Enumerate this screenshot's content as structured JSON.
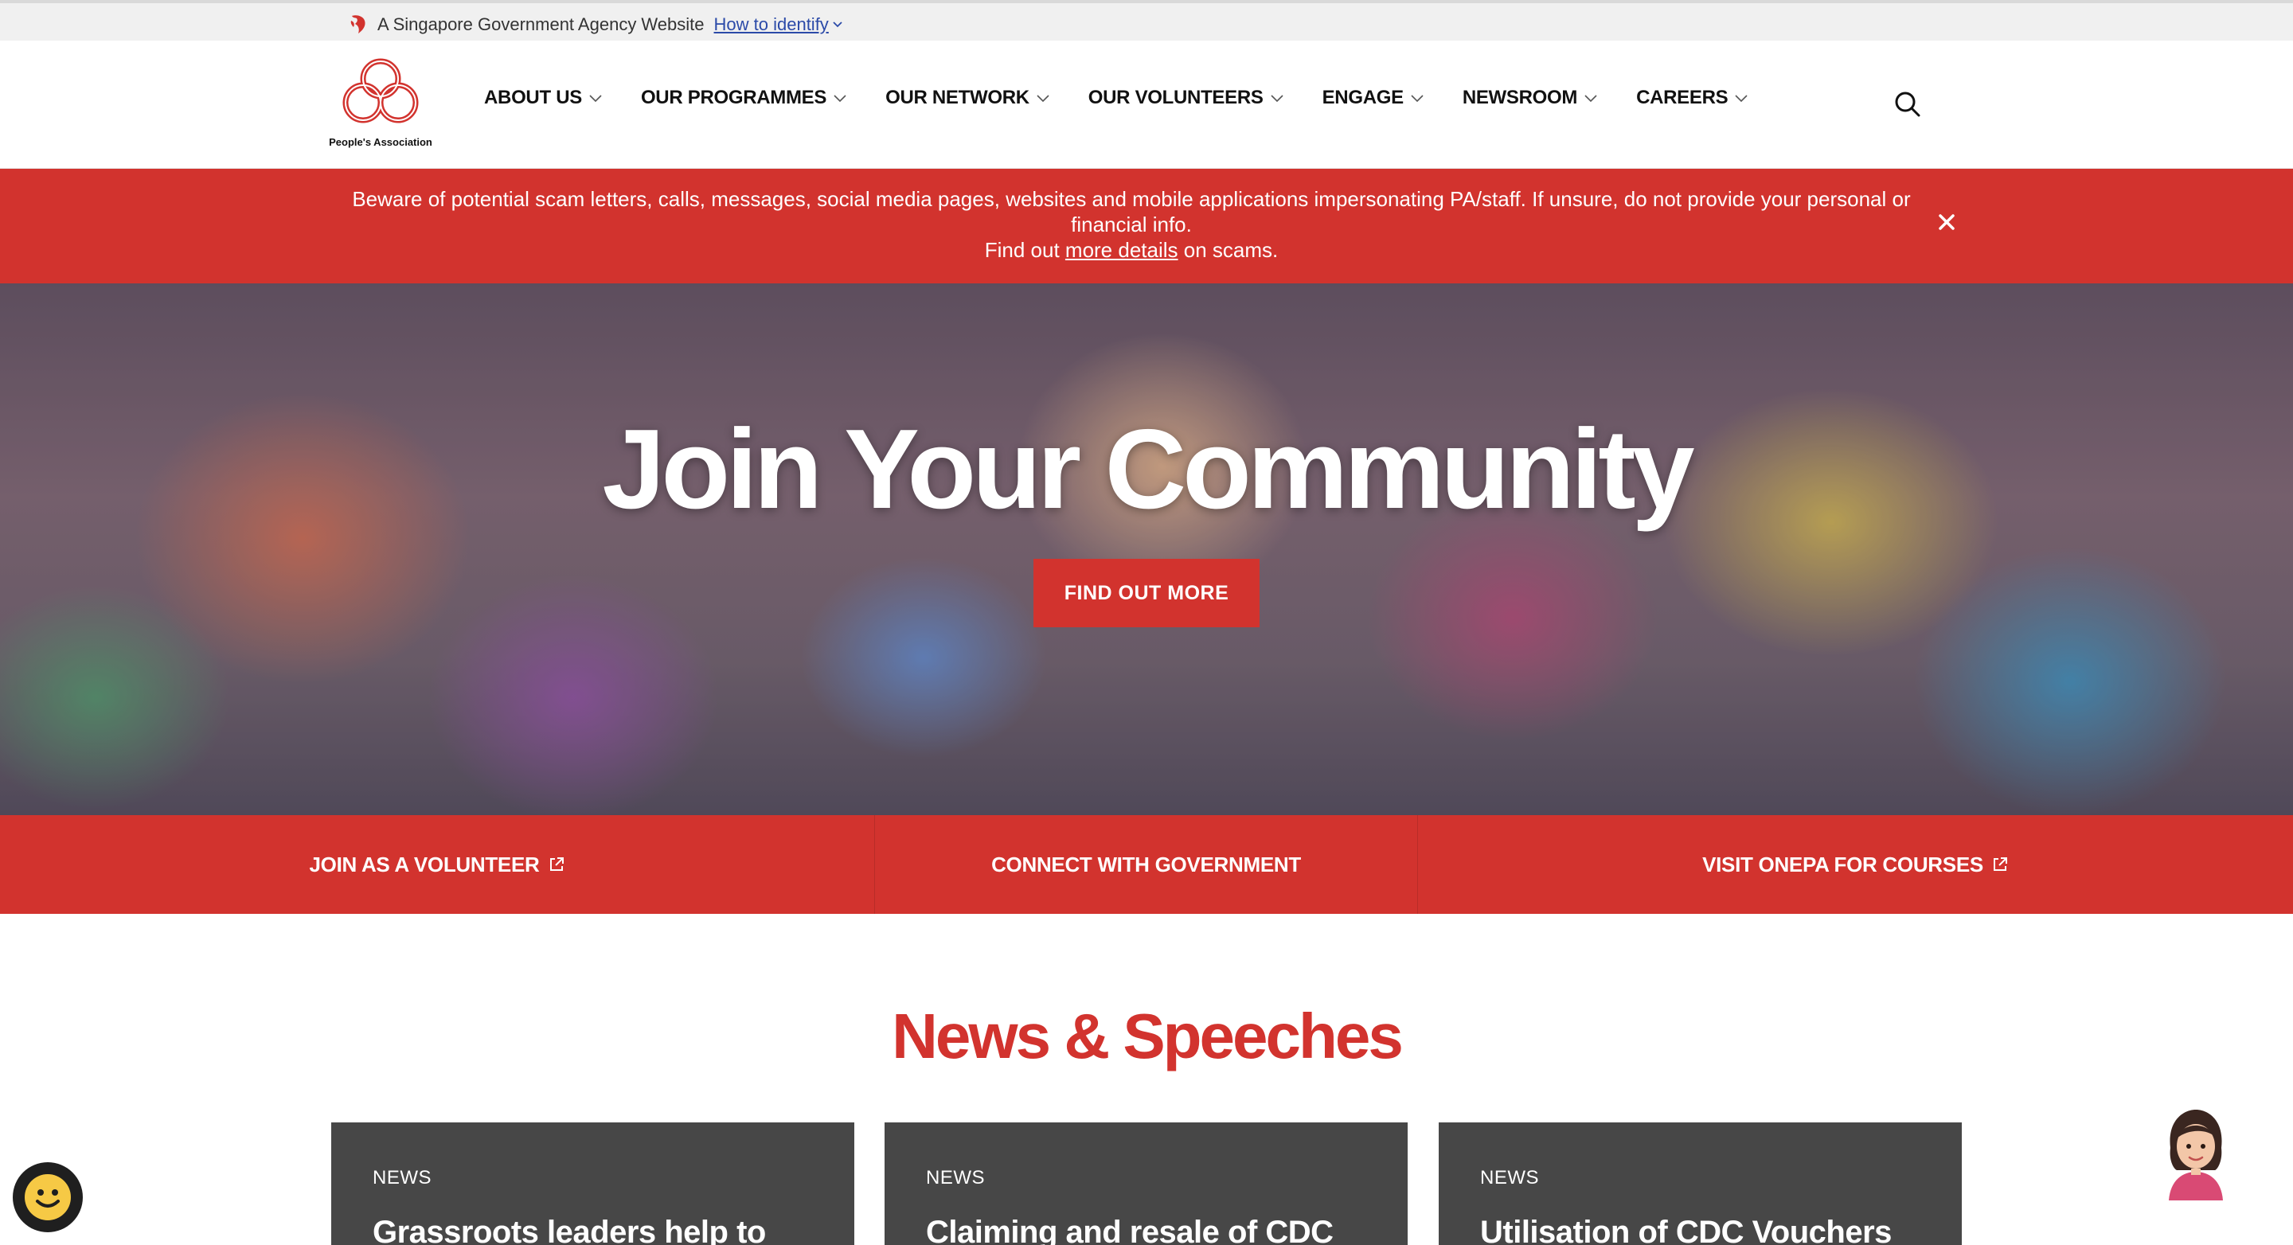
{
  "masthead": {
    "text": "A Singapore Government Agency Website",
    "link": "How to identify"
  },
  "logo": {
    "text": "People's Association"
  },
  "nav": {
    "items": [
      {
        "label": "ABOUT US"
      },
      {
        "label": "OUR PROGRAMMES"
      },
      {
        "label": "OUR NETWORK"
      },
      {
        "label": "OUR VOLUNTEERS"
      },
      {
        "label": "ENGAGE"
      },
      {
        "label": "NEWSROOM"
      },
      {
        "label": "CAREERS"
      }
    ],
    "search_icon": "search-icon"
  },
  "alert": {
    "message": "Beware of potential scam letters, calls, messages, social media pages, websites and mobile applications impersonating PA/staff. If unsure, do not provide your personal or financial info.",
    "find_prefix": "Find out ",
    "link": "more details",
    "find_suffix": " on scams.",
    "close_icon": "close-icon"
  },
  "hero": {
    "title": "Join Your Community",
    "cta": "FIND OUT MORE"
  },
  "quick_links": [
    {
      "label": "JOIN AS A VOLUNTEER",
      "external": true
    },
    {
      "label": "CONNECT WITH GOVERNMENT",
      "external": false
    },
    {
      "label": "VISIT ONEPA FOR COURSES",
      "external": true
    }
  ],
  "news": {
    "heading": "News & Speeches",
    "cards": [
      {
        "category": "NEWS",
        "title": "Grassroots leaders help to"
      },
      {
        "category": "NEWS",
        "title": "Claiming and resale of CDC"
      },
      {
        "category": "NEWS",
        "title": "Utilisation of CDC Vouchers"
      }
    ]
  },
  "colors": {
    "brand_red": "#d2332e",
    "card_gray": "#474747",
    "masthead_bg": "#f0f0f0",
    "link_blue": "#2b4aa8"
  }
}
